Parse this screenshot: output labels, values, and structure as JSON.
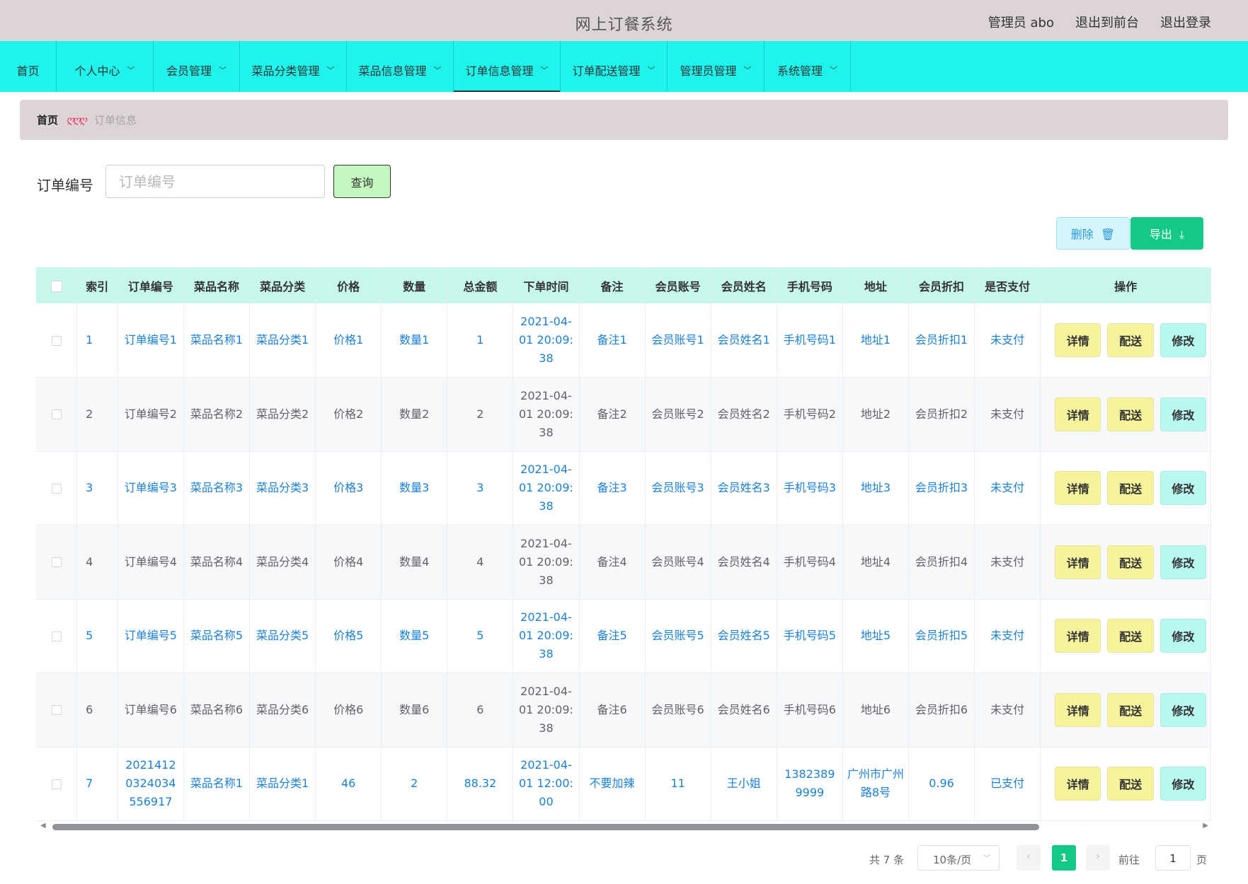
{
  "header": {
    "title": "网上订餐系统",
    "admin": "管理员 abo",
    "to_front": "退出到前台",
    "logout": "退出登录"
  },
  "nav": [
    {
      "label": "首页",
      "has_menu": false,
      "active": false
    },
    {
      "label": "个人中心",
      "has_menu": true,
      "active": false
    },
    {
      "label": "会员管理",
      "has_menu": true,
      "active": false
    },
    {
      "label": "菜品分类管理",
      "has_menu": true,
      "active": false
    },
    {
      "label": "菜品信息管理",
      "has_menu": true,
      "active": false
    },
    {
      "label": "订单信息管理",
      "has_menu": true,
      "active": true
    },
    {
      "label": "订单配送管理",
      "has_menu": true,
      "active": false
    },
    {
      "label": "管理员管理",
      "has_menu": true,
      "active": false
    },
    {
      "label": "系统管理",
      "has_menu": true,
      "active": false
    }
  ],
  "breadcrumb": {
    "home": "首页",
    "separator": "ღღღ",
    "current": "订单信息"
  },
  "search": {
    "label": "订单编号",
    "placeholder": "订单编号",
    "value": "",
    "button": "查询"
  },
  "toolbar": {
    "delete_label": "删除",
    "delete_icon": "trash-icon",
    "export_label": "导出",
    "export_icon": "download-icon"
  },
  "table": {
    "columns": [
      "索引",
      "订单编号",
      "菜品名称",
      "菜品分类",
      "价格",
      "数量",
      "总金额",
      "下单时间",
      "备注",
      "会员账号",
      "会员姓名",
      "手机号码",
      "地址",
      "会员折扣",
      "是否支付",
      "操作"
    ],
    "rows": [
      [
        "1",
        "订单编号1",
        "菜品名称1",
        "菜品分类1",
        "价格1",
        "数量1",
        "1",
        "2021-04-01 20:09:38",
        "备注1",
        "会员账号1",
        "会员姓名1",
        "手机号码1",
        "地址1",
        "会员折扣1",
        "未支付"
      ],
      [
        "2",
        "订单编号2",
        "菜品名称2",
        "菜品分类2",
        "价格2",
        "数量2",
        "2",
        "2021-04-01 20:09:38",
        "备注2",
        "会员账号2",
        "会员姓名2",
        "手机号码2",
        "地址2",
        "会员折扣2",
        "未支付"
      ],
      [
        "3",
        "订单编号3",
        "菜品名称3",
        "菜品分类3",
        "价格3",
        "数量3",
        "3",
        "2021-04-01 20:09:38",
        "备注3",
        "会员账号3",
        "会员姓名3",
        "手机号码3",
        "地址3",
        "会员折扣3",
        "未支付"
      ],
      [
        "4",
        "订单编号4",
        "菜品名称4",
        "菜品分类4",
        "价格4",
        "数量4",
        "4",
        "2021-04-01 20:09:38",
        "备注4",
        "会员账号4",
        "会员姓名4",
        "手机号码4",
        "地址4",
        "会员折扣4",
        "未支付"
      ],
      [
        "5",
        "订单编号5",
        "菜品名称5",
        "菜品分类5",
        "价格5",
        "数量5",
        "5",
        "2021-04-01 20:09:38",
        "备注5",
        "会员账号5",
        "会员姓名5",
        "手机号码5",
        "地址5",
        "会员折扣5",
        "未支付"
      ],
      [
        "6",
        "订单编号6",
        "菜品名称6",
        "菜品分类6",
        "价格6",
        "数量6",
        "6",
        "2021-04-01 20:09:38",
        "备注6",
        "会员账号6",
        "会员姓名6",
        "手机号码6",
        "地址6",
        "会员折扣6",
        "未支付"
      ],
      [
        "7",
        "20214120324034556917",
        "菜品名称1",
        "菜品分类1",
        "46",
        "2",
        "88.32",
        "2021-04-01 12:00:00",
        "不要加辣",
        "11",
        "王小姐",
        "13823899999",
        "广州市广州路8号",
        "0.96",
        "已支付"
      ]
    ],
    "actions": {
      "detail": "详情",
      "deliver": "配送",
      "edit": "修改"
    }
  },
  "pagination": {
    "total": "共 7 条",
    "page_size": "10条/页",
    "current_page": "1",
    "goto_label": "前往",
    "goto_value": "1",
    "page_suffix": "页"
  },
  "colors": {
    "nav_bg": "#1ff4ec",
    "header_bg": "#ddd5d5",
    "table_header_bg": "#c7f6ec",
    "link_blue": "#1a7fd6",
    "export_green": "#14c888",
    "action_yellow": "#f5f39b",
    "edit_cyan": "#b8f8f1"
  }
}
